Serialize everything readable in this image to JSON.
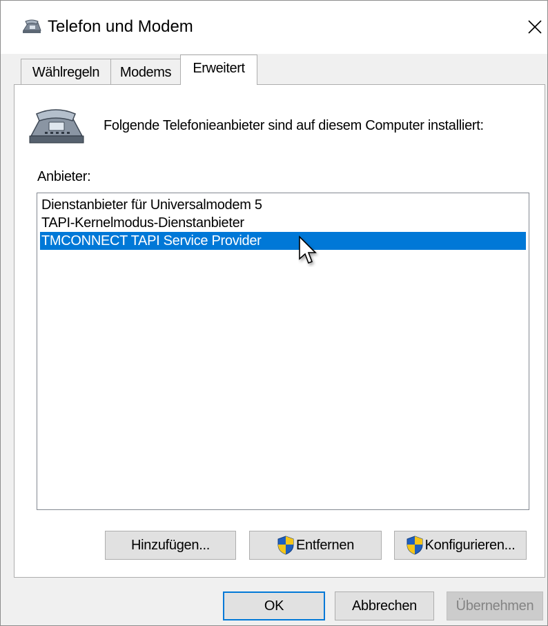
{
  "window": {
    "title": "Telefon und Modem",
    "close_icon": "close-icon",
    "title_icon": "phone-modem-icon"
  },
  "tabs": [
    {
      "label": "Wählregeln",
      "active": false
    },
    {
      "label": "Modems",
      "active": false
    },
    {
      "label": "Erweitert",
      "active": true
    }
  ],
  "advanced": {
    "description": "Folgende Telefonieanbieter sind auf diesem Computer installiert:",
    "providers_label": "Anbieter:",
    "providers": [
      {
        "name": "Dienstanbieter für Universalmodem 5",
        "selected": false
      },
      {
        "name": "TAPI-Kernelmodus-Dienstanbieter",
        "selected": false
      },
      {
        "name": "TMCONNECT TAPI Service Provider",
        "selected": true
      }
    ],
    "buttons": {
      "add": "Hinzufügen...",
      "remove": "Entfernen",
      "configure": "Konfigurieren..."
    }
  },
  "footer": {
    "ok": "OK",
    "cancel": "Abbrechen",
    "apply": "Übernehmen"
  },
  "colors": {
    "selection": "#0078d7",
    "dialog_bg": "#f0f0f0",
    "button_bg": "#e1e1e1"
  }
}
